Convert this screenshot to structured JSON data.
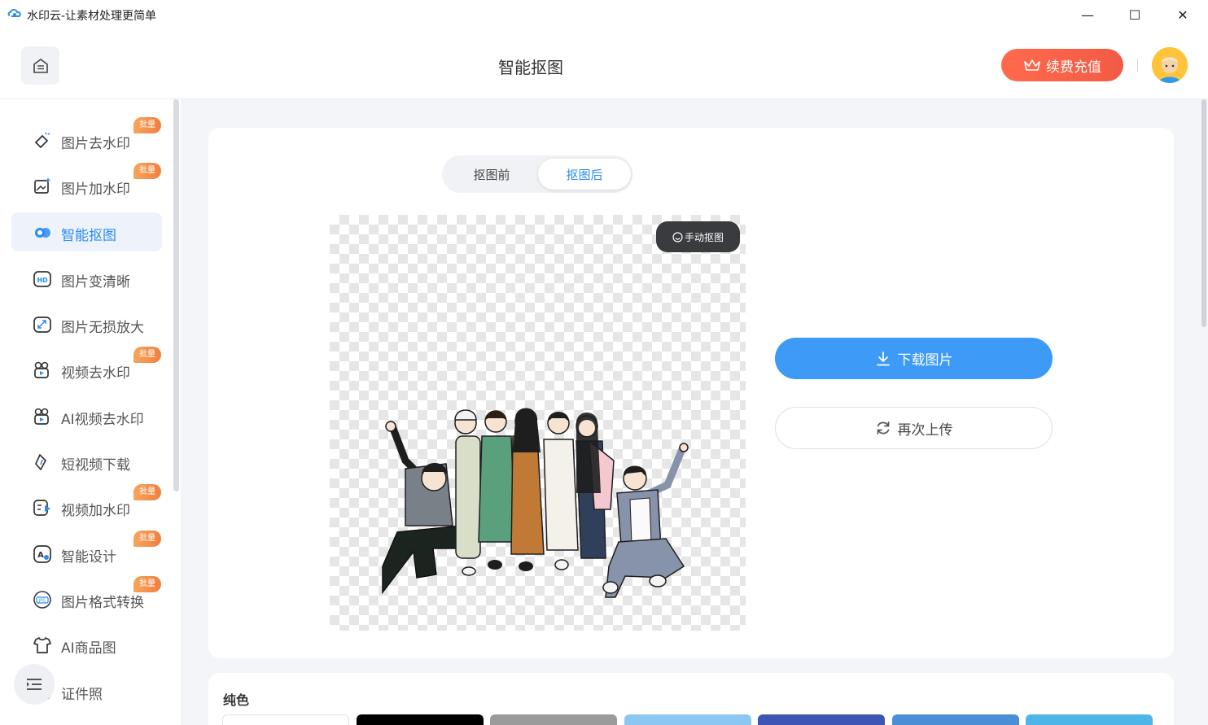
{
  "window": {
    "title": "水印云-让素材处理更简单",
    "minimize_glyph": "—",
    "maximize_glyph": "☐",
    "close_glyph": "✕"
  },
  "header": {
    "title": "智能抠图",
    "vip_label": "续费充值"
  },
  "sidebar": {
    "items": [
      {
        "label": "图片去水印",
        "badge": "批量",
        "icon": "eraser-icon"
      },
      {
        "label": "图片加水印",
        "badge": "批量",
        "icon": "image-add-icon"
      },
      {
        "label": "智能抠图",
        "badge": "",
        "icon": "cutout-icon",
        "active": true
      },
      {
        "label": "图片变清晰",
        "badge": "",
        "icon": "hd-icon"
      },
      {
        "label": "图片无损放大",
        "badge": "",
        "icon": "enlarge-icon"
      },
      {
        "label": "视频去水印",
        "badge": "批量",
        "icon": "video-eraser-icon"
      },
      {
        "label": "AI视频去水印",
        "badge": "",
        "icon": "ai-video-icon"
      },
      {
        "label": "短视频下载",
        "badge": "",
        "icon": "link-download-icon"
      },
      {
        "label": "视频加水印",
        "badge": "批量",
        "icon": "video-add-icon"
      },
      {
        "label": "智能设计",
        "badge": "批量",
        "icon": "design-icon"
      },
      {
        "label": "图片格式转换",
        "badge": "批量",
        "icon": "jpg-icon"
      },
      {
        "label": "AI商品图",
        "badge": "",
        "icon": "shirt-icon"
      },
      {
        "label": "证件照",
        "badge": "",
        "icon": "id-photo-icon"
      }
    ]
  },
  "editor": {
    "tab_before": "抠图前",
    "tab_after": "抠图后",
    "active_tab": "抠图后",
    "manual_label": "手动抠图",
    "download_label": "下载图片",
    "reupload_label": "再次上传"
  },
  "background": {
    "section_title": "纯色",
    "swatches": [
      "#ffffff",
      "#000000",
      "#9b9b9b",
      "#8cc7f2",
      "#3d56b5",
      "#4a8fd6",
      "#4db5e8"
    ]
  },
  "colors": {
    "accent": "#2a8cf0",
    "vip_gradient_start": "#ff6a4d",
    "badge": "#f07e3f"
  }
}
